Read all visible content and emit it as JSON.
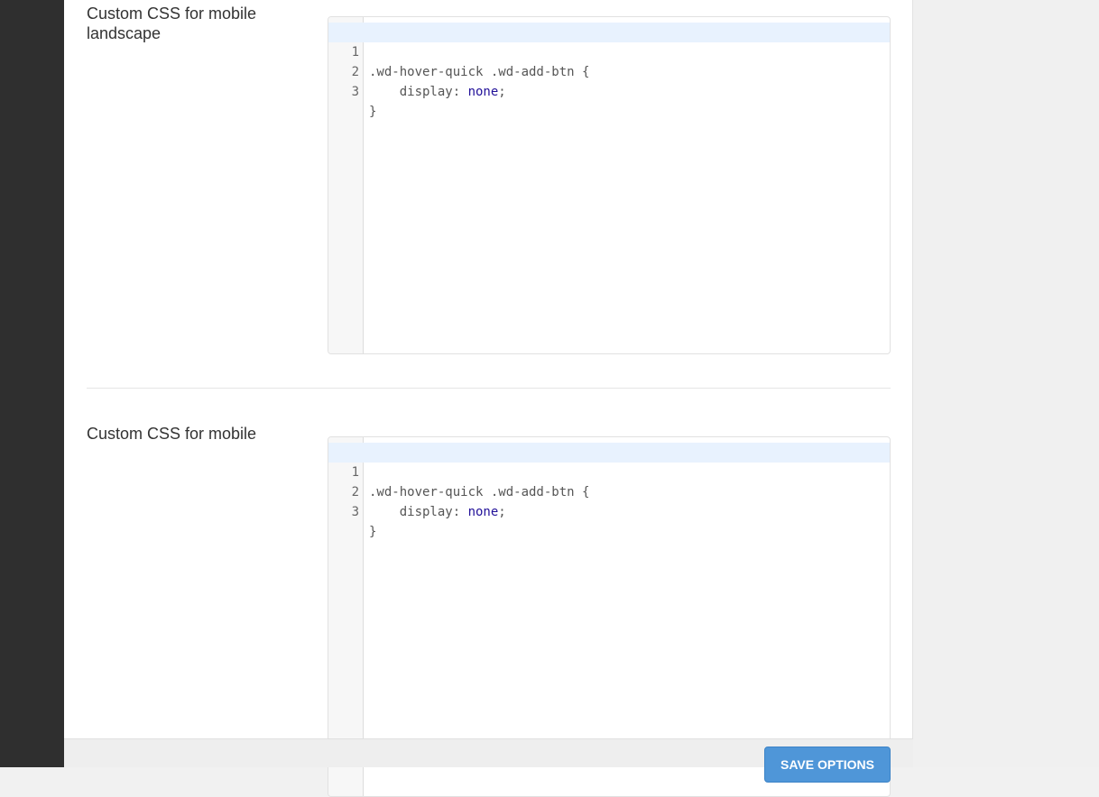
{
  "sections": [
    {
      "label": "Custom CSS for mobile landscape",
      "code_lines": [
        {
          "num": "1",
          "before": ".wd-hover-quick .wd-add-btn {",
          "value": "",
          "after": ""
        },
        {
          "num": "2",
          "before": "    display: ",
          "value": "none",
          "after": ";"
        },
        {
          "num": "3",
          "before": "}",
          "value": "",
          "after": ""
        }
      ]
    },
    {
      "label": "Custom CSS for mobile",
      "code_lines": [
        {
          "num": "1",
          "before": ".wd-hover-quick .wd-add-btn {",
          "value": "",
          "after": ""
        },
        {
          "num": "2",
          "before": "    display: ",
          "value": "none",
          "after": ";"
        },
        {
          "num": "3",
          "before": "}",
          "value": "",
          "after": ""
        }
      ]
    }
  ],
  "footer": {
    "save_label": "SAVE OPTIONS"
  },
  "colors": {
    "sidebar": "#2f2f2f",
    "active_line": "#e8f2fe",
    "css_value_keyword": "#221199",
    "save_button": "#4f96d8"
  }
}
